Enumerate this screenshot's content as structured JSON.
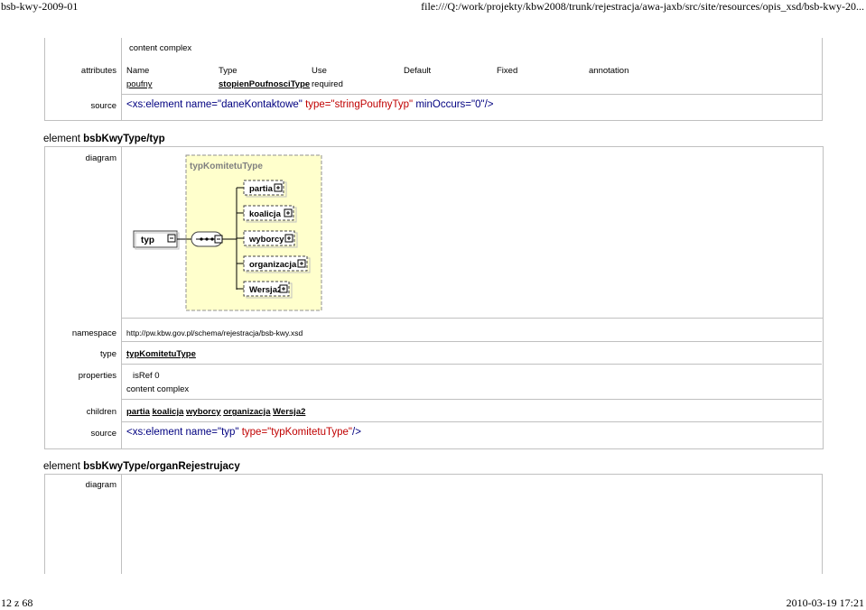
{
  "header": {
    "left": "bsb-kwy-2009-01",
    "right": "file:///Q:/work/projekty/kbw2008/trunk/rejestracja/awa-jaxb/src/site/resources/opis_xsd/bsb-kwy-20..."
  },
  "footer": {
    "left": "12 z 68",
    "right": "2010-03-19 17:21"
  },
  "top_block": {
    "content": "content complex",
    "attributes_label": "attributes",
    "attr_headers": [
      "Name",
      "Type",
      "Use",
      "Default",
      "Fixed",
      "annotation"
    ],
    "attr_row": {
      "name": "poufny",
      "type": "stopienPoufnosciType",
      "use": "required"
    },
    "source_label": "source",
    "source": {
      "tag_open": "<xs:element ",
      "attr1": "name=\"daneKontaktowe\" ",
      "attr2": "type=\"stringPoufnyTyp\" ",
      "attr3": "minOccurs=\"0\"",
      "tag_close": "/>"
    }
  },
  "element_typ": {
    "title_prefix": "element ",
    "title_name": "bsbKwyType/typ",
    "diagram_label": "diagram",
    "diagram": {
      "root": "typ",
      "type_name": "typKomitetuType",
      "children": [
        "partia",
        "koalicja",
        "wyborcy",
        "organizacja",
        "Wersja2"
      ]
    },
    "namespace_label": "namespace",
    "namespace": "http://pw.kbw.gov.pl/schema/rejestracja/bsb-kwy.xsd",
    "type_label": "type",
    "type": "typKomitetuType",
    "properties_label": "properties",
    "properties": [
      "isRef 0",
      "content complex"
    ],
    "children_label": "children",
    "children": [
      "partia",
      "koalicja",
      "wyborcy",
      "organizacja",
      "Wersja2"
    ],
    "source_label": "source",
    "source": {
      "tag_open": "<xs:element ",
      "attr1": "name=\"typ\" ",
      "attr2": "type=\"typKomitetuType\"",
      "tag_close": "/>"
    }
  },
  "element_organ": {
    "title_prefix": "element ",
    "title_name": "bsbKwyType/organRejestrujacy",
    "diagram_label": "diagram"
  }
}
